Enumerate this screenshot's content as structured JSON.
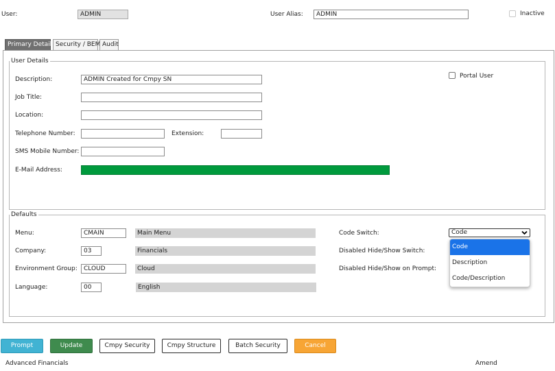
{
  "header": {
    "user_label": "User:",
    "user_value": "ADMIN",
    "alias_label": "User Alias:",
    "alias_value": "ADMIN",
    "inactive_label": "Inactive"
  },
  "tabs": [
    {
      "label": "Primary Details"
    },
    {
      "label": "Security / BEM"
    },
    {
      "label": "Audit"
    }
  ],
  "user_details": {
    "legend": "User Details",
    "description_label": "Description:",
    "description_value": "ADMIN Created for Cmpy SN",
    "job_title_label": "Job Title:",
    "job_title_value": "",
    "location_label": "Location:",
    "location_value": "",
    "telephone_label": "Telephone Number:",
    "telephone_value": "",
    "extension_label": "Extension:",
    "extension_value": "",
    "sms_label": "SMS Mobile Number:",
    "sms_value": "",
    "email_label": "E-Mail Address:",
    "email_value": "",
    "email_fill_color": "#009a3d",
    "portal_user_label": "Portal User"
  },
  "defaults": {
    "legend": "Defaults",
    "menu_label": "Menu:",
    "menu_code": "CMAIN",
    "menu_desc": "Main Menu",
    "company_label": "Company:",
    "company_code": "03",
    "company_desc": "Financials",
    "env_label": "Environment Group:",
    "env_code": "CLOUD",
    "env_desc": "Cloud",
    "language_label": "Language:",
    "language_code": "00",
    "language_desc": "English",
    "code_switch_label": "Code Switch:",
    "code_switch_value": "Code",
    "code_switch_options": [
      "Code",
      "Description",
      "Code/Description"
    ],
    "disabled_hide_show_label": "Disabled Hide/Show Switch:",
    "disabled_prompt_label": "Disabled Hide/Show on Prompt:"
  },
  "buttons": {
    "prompt": "Prompt",
    "update": "Update",
    "cmpy_security": "Cmpy Security",
    "cmpy_structure": "Cmpy Structure",
    "batch_security": "Batch Security",
    "cancel": "Cancel"
  },
  "footer": {
    "left": "Advanced Financials",
    "right": "Amend"
  },
  "colors": {
    "prompt_button": "#41b3d3",
    "update_button": "#3f8b4e",
    "cancel_button": "#f7a535",
    "active_tab": "#707070",
    "dropdown_highlight": "#1a73e8"
  }
}
